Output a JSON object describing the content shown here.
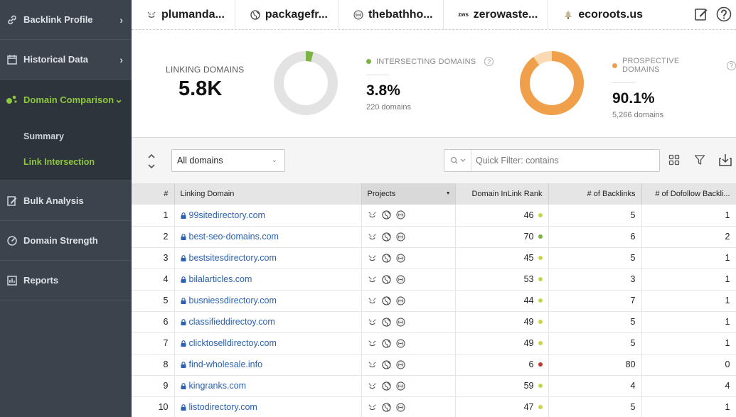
{
  "sidebar": {
    "items": [
      {
        "label": "Backlink Profile",
        "icon": "link-icon",
        "chevron": "›"
      },
      {
        "label": "Historical Data",
        "icon": "calendar-icon",
        "chevron": "›"
      },
      {
        "label": "Domain Comparison",
        "icon": "bubbles-icon",
        "chevron": "⌄"
      },
      {
        "label": "Bulk Analysis",
        "icon": "edit-list-icon"
      },
      {
        "label": "Domain Strength",
        "icon": "gauge-icon"
      },
      {
        "label": "Reports",
        "icon": "report-icon"
      }
    ],
    "subitems": [
      {
        "label": "Summary"
      },
      {
        "label": "Link Intersection"
      }
    ]
  },
  "projects": [
    {
      "name": "plumanda...",
      "icon": "face-icon"
    },
    {
      "name": "packagefr...",
      "icon": "globe-icon"
    },
    {
      "name": "thebathho...",
      "icon": "badge-icon"
    },
    {
      "name": "zerowaste...",
      "icon": "zws-logo-icon",
      "logo_text": "zws"
    },
    {
      "name": "ecoroots.us",
      "icon": "tree-icon"
    }
  ],
  "summary": {
    "linking_domains_label": "LINKING DOMAINS",
    "linking_domains_value": "5.8K",
    "intersecting": {
      "label": "INTERSECTING DOMAINS",
      "value": "3.8%",
      "sub": "220 domains",
      "fraction": 0.038,
      "color": "#7cb342"
    },
    "prospective": {
      "label": "PROSPECTIVE DOMAINS",
      "value": "90.1%",
      "sub": "5,266 domains",
      "fraction": 0.901,
      "color": "#f0a04b"
    },
    "help_glyph": "?"
  },
  "toolbar": {
    "select_value": "All domains",
    "select_arrow": "⌄",
    "filter_placeholder": "Quick Filter: contains"
  },
  "table": {
    "headers": {
      "num": "#",
      "domain": "Linking Domain",
      "projects": "Projects",
      "rank": "Domain InLink Rank",
      "backlinks": "# of Backlinks",
      "dofollow": "# of Dofollow Backli..."
    },
    "rows": [
      {
        "n": "1",
        "domain": "99sitedirectory.com",
        "rank": "46",
        "rank_color": "#c6d64c",
        "backlinks": "5",
        "dofollow": "1"
      },
      {
        "n": "2",
        "domain": "best-seo-domains.com",
        "rank": "70",
        "rank_color": "#7cb342",
        "backlinks": "6",
        "dofollow": "2"
      },
      {
        "n": "3",
        "domain": "bestsitesdirectory.com",
        "rank": "45",
        "rank_color": "#c6d64c",
        "backlinks": "5",
        "dofollow": "1"
      },
      {
        "n": "4",
        "domain": "bilalarticles.com",
        "rank": "53",
        "rank_color": "#c6d64c",
        "backlinks": "3",
        "dofollow": "1"
      },
      {
        "n": "5",
        "domain": "busniessdirectory.com",
        "rank": "44",
        "rank_color": "#c6d64c",
        "backlinks": "7",
        "dofollow": "1"
      },
      {
        "n": "6",
        "domain": "classifieddirectoy.com",
        "rank": "49",
        "rank_color": "#c6d64c",
        "backlinks": "5",
        "dofollow": "1"
      },
      {
        "n": "7",
        "domain": "clicktoselldirectoy.com",
        "rank": "49",
        "rank_color": "#c6d64c",
        "backlinks": "5",
        "dofollow": "1"
      },
      {
        "n": "8",
        "domain": "find-wholesale.info",
        "rank": "6",
        "rank_color": "#c0392b",
        "backlinks": "80",
        "dofollow": "0"
      },
      {
        "n": "9",
        "domain": "kingranks.com",
        "rank": "59",
        "rank_color": "#c6d64c",
        "backlinks": "4",
        "dofollow": "4"
      },
      {
        "n": "10",
        "domain": "listodirectory.com",
        "rank": "47",
        "rank_color": "#c6d64c",
        "backlinks": "5",
        "dofollow": "1"
      }
    ]
  }
}
